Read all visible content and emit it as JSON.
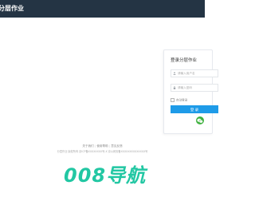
{
  "header": {
    "title": "分层作业"
  },
  "login": {
    "title": "登录分层作业",
    "username_placeholder": "请输入用户名",
    "password_placeholder": "请输入密码",
    "remember_label": "自动登录",
    "submit_label": "登 录"
  },
  "footer": {
    "links": [
      "关于我们",
      "使用帮助",
      "意见反馈"
    ],
    "copyright": "分层作业 版权所有 京ICP备XXXXXXXX号-X 京公网安备XXXXXXXXXXXXXX号"
  },
  "brand": {
    "text": "008导航"
  },
  "colors": {
    "topbar": "#243444",
    "accent": "#1e9be8",
    "wechat": "#3fb13f",
    "brand": "#22c7a3"
  }
}
